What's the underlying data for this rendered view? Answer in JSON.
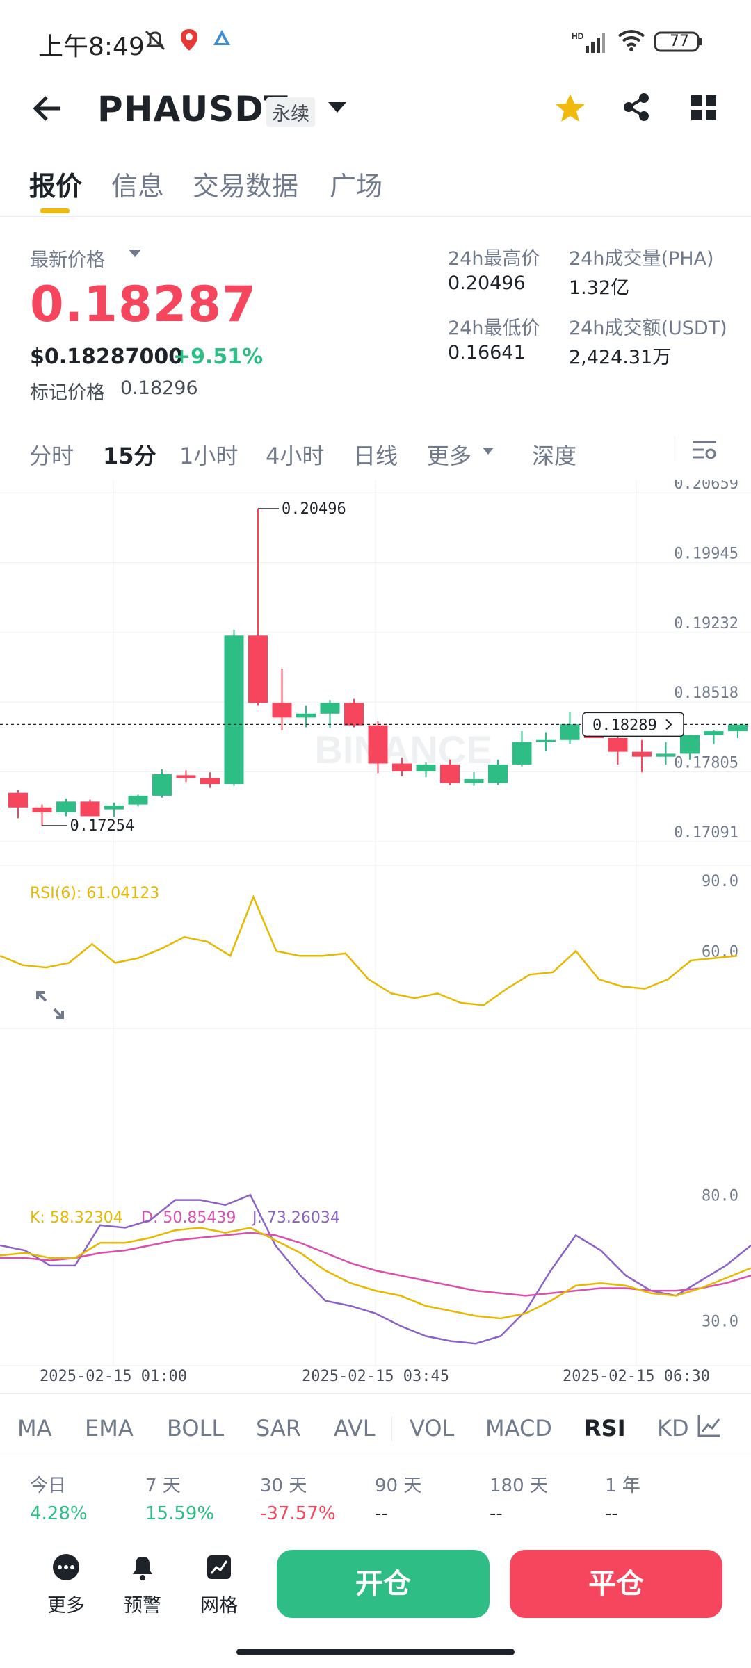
{
  "status_bar": {
    "time": "上午8:49",
    "battery": "77"
  },
  "header": {
    "title": "PHAUSDT",
    "badge": "永续"
  },
  "tabs": [
    "报价",
    "信息",
    "交易数据",
    "广场"
  ],
  "price": {
    "label": "最新价格",
    "last": "0.18287",
    "usd": "$0.18287000",
    "change": "+9.51%",
    "mark_label": "标记价格",
    "mark_value": "0.18296"
  },
  "stats": {
    "high_label": "24h最高价",
    "high": "0.20496",
    "low_label": "24h最低价",
    "low": "0.16641",
    "vol_label": "24h成交量(PHA)",
    "vol": "1.32亿",
    "amount_label": "24h成交额(USDT)",
    "amount": "2,424.31万"
  },
  "intervals": [
    "分时",
    "15分",
    "1小时",
    "4小时",
    "日线",
    "更多",
    "深度"
  ],
  "chart": {
    "watermark": "BINANCE",
    "y_labels": [
      "0.20659",
      "0.19945",
      "0.19232",
      "0.18518",
      "0.17805",
      "0.17091"
    ],
    "high_marker": "0.20496",
    "low_marker": "0.17254",
    "current_price_tag": "0.18289",
    "rsi_label": "RSI(6): 61.04123",
    "rsi_levels": [
      "90.0",
      "60.0"
    ],
    "k_label": "K: 58.32304",
    "d_label": "D: 50.85439",
    "j_label": "J: 73.26034",
    "kdj_levels": [
      "80.0",
      "30.0"
    ],
    "x_labels": [
      "2025-02-15 01:00",
      "2025-02-15 03:45",
      "2025-02-15 06:30"
    ],
    "colors": {
      "up": "#2ebd85",
      "down": "#f6465d",
      "rsi": "#e6b800",
      "k": "#e6b800",
      "d": "#d94fae",
      "j": "#8b63c7"
    }
  },
  "indicators": [
    "MA",
    "EMA",
    "BOLL",
    "SAR",
    "AVL",
    "VOL",
    "MACD",
    "RSI",
    "KD"
  ],
  "performance": {
    "labels": [
      "今日",
      "7 天",
      "30 天",
      "90 天",
      "180 天",
      "1 年"
    ],
    "values": [
      "4.28%",
      "15.59%",
      "-37.57%",
      "--",
      "--",
      "--"
    ]
  },
  "bottom_bar": {
    "more": "更多",
    "alert": "预警",
    "grid": "网格",
    "open": "开仓",
    "close": "平仓"
  },
  "chart_data": {
    "type": "candlestick",
    "interval": "15分",
    "candles": [
      {
        "o": 0.1759,
        "h": 0.1762,
        "l": 0.1733,
        "c": 0.1744
      },
      {
        "o": 0.1744,
        "h": 0.1747,
        "l": 0.1725,
        "c": 0.1739
      },
      {
        "o": 0.1739,
        "h": 0.1753,
        "l": 0.1735,
        "c": 0.175
      },
      {
        "o": 0.175,
        "h": 0.1752,
        "l": 0.174,
        "c": 0.1735
      },
      {
        "o": 0.1742,
        "h": 0.1749,
        "l": 0.1734,
        "c": 0.1746
      },
      {
        "o": 0.1747,
        "h": 0.1757,
        "l": 0.1745,
        "c": 0.1756
      },
      {
        "o": 0.1756,
        "h": 0.1783,
        "l": 0.1754,
        "c": 0.1778
      },
      {
        "o": 0.1777,
        "h": 0.1782,
        "l": 0.177,
        "c": 0.1774
      },
      {
        "o": 0.1774,
        "h": 0.178,
        "l": 0.1764,
        "c": 0.1768
      },
      {
        "o": 0.1768,
        "h": 0.1926,
        "l": 0.1766,
        "c": 0.192
      },
      {
        "o": 0.192,
        "h": 0.20496,
        "l": 0.1848,
        "c": 0.1851
      },
      {
        "o": 0.1851,
        "h": 0.1886,
        "l": 0.1823,
        "c": 0.1836
      },
      {
        "o": 0.1836,
        "h": 0.1848,
        "l": 0.1826,
        "c": 0.184
      },
      {
        "o": 0.184,
        "h": 0.1854,
        "l": 0.1825,
        "c": 0.1851
      },
      {
        "o": 0.1851,
        "h": 0.1855,
        "l": 0.1826,
        "c": 0.1828
      },
      {
        "o": 0.1828,
        "h": 0.1832,
        "l": 0.1779,
        "c": 0.1789
      },
      {
        "o": 0.1789,
        "h": 0.1795,
        "l": 0.1776,
        "c": 0.1781
      },
      {
        "o": 0.1781,
        "h": 0.179,
        "l": 0.1775,
        "c": 0.1788
      },
      {
        "o": 0.1788,
        "h": 0.1793,
        "l": 0.1767,
        "c": 0.1769
      },
      {
        "o": 0.1769,
        "h": 0.178,
        "l": 0.1766,
        "c": 0.1773
      },
      {
        "o": 0.1769,
        "h": 0.1793,
        "l": 0.1767,
        "c": 0.1788
      },
      {
        "o": 0.1788,
        "h": 0.1822,
        "l": 0.1786,
        "c": 0.1811
      },
      {
        "o": 0.1811,
        "h": 0.1821,
        "l": 0.1802,
        "c": 0.1813
      },
      {
        "o": 0.1813,
        "h": 0.1842,
        "l": 0.1809,
        "c": 0.1829
      },
      {
        "o": 0.1828,
        "h": 0.1839,
        "l": 0.1815,
        "c": 0.1815
      },
      {
        "o": 0.1815,
        "h": 0.1818,
        "l": 0.1788,
        "c": 0.1801
      },
      {
        "o": 0.1801,
        "h": 0.1813,
        "l": 0.178,
        "c": 0.1796
      },
      {
        "o": 0.1796,
        "h": 0.1811,
        "l": 0.1788,
        "c": 0.1799
      },
      {
        "o": 0.1799,
        "h": 0.1818,
        "l": 0.1793,
        "c": 0.1818
      },
      {
        "o": 0.1818,
        "h": 0.1823,
        "l": 0.1809,
        "c": 0.1822
      },
      {
        "o": 0.1822,
        "h": 0.1828,
        "l": 0.1815,
        "c": 0.18287
      }
    ],
    "rsi": [
      58,
      54,
      53,
      55,
      63,
      55,
      57,
      61,
      66,
      64,
      58,
      83,
      60,
      58,
      58,
      59,
      48,
      42,
      40,
      42,
      38,
      37,
      44,
      50,
      51,
      60,
      48,
      45,
      44,
      48,
      56,
      57,
      58
    ],
    "k": [
      56,
      57,
      55,
      55,
      61,
      61,
      63,
      66,
      67,
      65,
      67,
      62,
      57,
      50,
      45,
      42,
      40,
      36,
      34,
      32,
      31,
      33,
      38,
      44,
      45,
      44,
      41,
      40,
      43,
      47,
      51
    ],
    "d": [
      55,
      55,
      54,
      55,
      57,
      58,
      60,
      62,
      63,
      64,
      65,
      64,
      61,
      57,
      53,
      50,
      48,
      46,
      44,
      42,
      41,
      40,
      41,
      42,
      43,
      43,
      42,
      42,
      43,
      45,
      48
    ],
    "j": [
      60,
      58,
      52,
      52,
      68,
      67,
      70,
      78,
      78,
      76,
      80,
      60,
      48,
      38,
      36,
      33,
      28,
      24,
      22,
      21,
      24,
      34,
      50,
      64,
      58,
      48,
      42,
      40,
      46,
      52,
      60
    ],
    "y_range": [
      0.16955,
      0.20795
    ],
    "x_ticks": [
      "2025-02-15 01:00",
      "2025-02-15 03:45",
      "2025-02-15 06:30"
    ],
    "ylabels": [
      "0.20659",
      "0.19945",
      "0.19232",
      "0.18518",
      "0.17805",
      "0.17091"
    ]
  }
}
